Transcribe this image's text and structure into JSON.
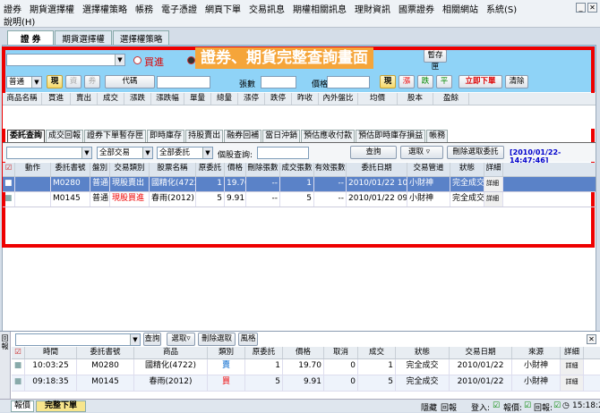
{
  "menu": {
    "row1": [
      "證券",
      "期貨選擇權",
      "選擇權策略",
      "帳務",
      "電子憑證",
      "網頁下單",
      "交易訊息",
      "期權相關訊息",
      "理財資訊",
      "國票證券",
      "相關網站",
      "系統(S)"
    ],
    "row2": [
      "說明(H)"
    ]
  },
  "top_tabs": [
    "證 券",
    "期貨選擇權",
    "選擇權策略"
  ],
  "overlay_title": "證券、期貨完整查詢畫面",
  "order": {
    "side_buy": "買進",
    "side_sell": "賣出",
    "type": "普通",
    "btn_cash": "現",
    "btn_margin": "資",
    "btn_short": "券",
    "code_label": "代碼",
    "qty_label": "張數",
    "price_label": "價格",
    "btn_now": "現",
    "btn_up": "漲",
    "btn_down": "跌",
    "btn_flat": "平",
    "btn_place": "立即下單",
    "btn_clear": "清除",
    "btn_temp": "暫存匣"
  },
  "quote_headers": [
    "商品名稱",
    "買進",
    "賣出",
    "成交",
    "漲跌",
    "漲跌幅",
    "單量",
    "總量",
    "漲停",
    "跌停",
    "昨收",
    "內外盤比",
    "均價",
    "股本",
    "盈餘"
  ],
  "sub_tabs": [
    "委託查詢",
    "成交回報",
    "證券下單暫存匣",
    "即時庫存",
    "持股賣出",
    "融券回補",
    "當日沖銷",
    "預估應收付款",
    "預估即時庫存損益",
    "帳務"
  ],
  "filter": {
    "f1": "",
    "f2": "全部交易",
    "f3": "全部委託",
    "stock_label": "個股查詢:",
    "btn_query": "查詢",
    "btn_select": "選取",
    "btn_delete": "刪除選取委託",
    "timestamp": "[2010/01/22-14:47:46]"
  },
  "orders_headers": [
    "動作",
    "委託書號",
    "盤別",
    "交易類別",
    "股票名稱",
    "原委託",
    "價格",
    "刪除張數",
    "成交張數",
    "有效張數",
    "委託日期",
    "交易管道",
    "狀態",
    "詳細"
  ],
  "orders": [
    {
      "no": "M0280",
      "session": "普通",
      "type": "現股賣出",
      "name": "國精化(4722)",
      "orig": "1",
      "price": "19.70",
      "del": "--",
      "filled": "1",
      "valid": "--",
      "date": "2010/01/22 10:03:25",
      "channel": "小財神",
      "status": "完全成交",
      "detail": "詳細"
    },
    {
      "no": "M0145",
      "session": "普通",
      "type": "現股買進",
      "name": "春雨(2012)",
      "orig": "5",
      "price": "9.91",
      "del": "--",
      "filled": "5",
      "valid": "--",
      "date": "2010/01/22 09:18:35",
      "channel": "小財神",
      "status": "完全成交",
      "detail": "詳細"
    }
  ],
  "report": {
    "side_label": "回報",
    "btn_query": "查詢",
    "btn_select": "選取",
    "btn_delete": "刪除選取",
    "btn_style": "風格",
    "headers": [
      "時間",
      "委託書號",
      "商品",
      "類別",
      "原委託",
      "價格",
      "取消",
      "成交",
      "狀態",
      "交易日期",
      "來源",
      "詳細"
    ],
    "rows": [
      {
        "time": "10:03:25",
        "no": "M0280",
        "product": "國精化(4722)",
        "kind": "賣",
        "orig": "1",
        "price": "19.70",
        "cancel": "0",
        "filled": "1",
        "status": "完全成交",
        "date": "2010/01/22",
        "source": "小財神",
        "detail": "詳細"
      },
      {
        "time": "09:18:35",
        "no": "M0145",
        "product": "春雨(2012)",
        "kind": "買",
        "orig": "5",
        "price": "9.91",
        "cancel": "0",
        "filled": "5",
        "status": "完全成交",
        "date": "2010/01/22",
        "source": "小財神",
        "detail": "詳細"
      }
    ]
  },
  "bottom_tabs": [
    "報價",
    "完整下單"
  ],
  "status": {
    "hide": "隱藏",
    "report": "回報",
    "login": "登入:",
    "quote": "報價:",
    "reply": "回報:",
    "time": "15:18:2"
  }
}
